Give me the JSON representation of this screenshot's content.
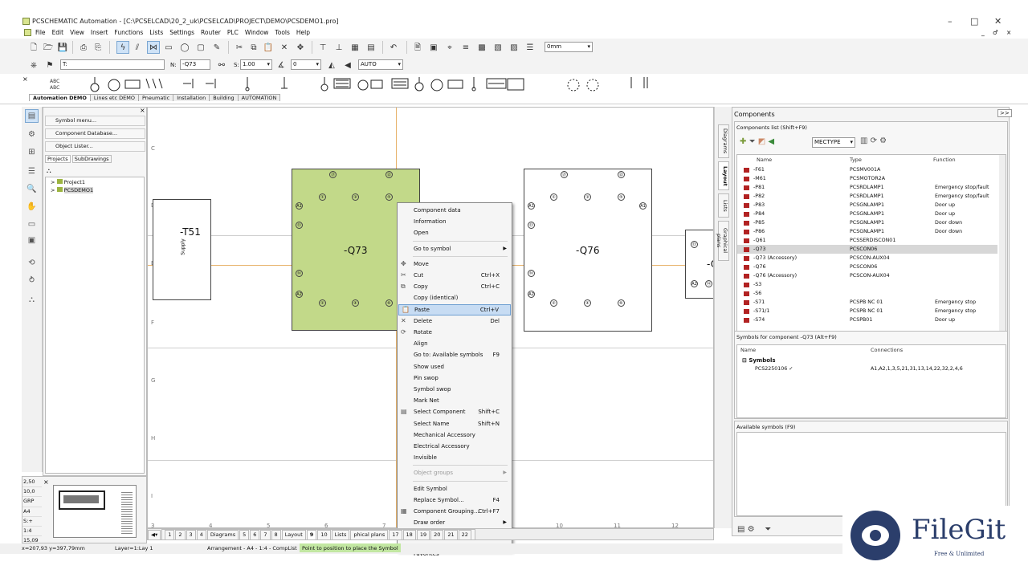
{
  "app": {
    "title": "PCSCHEMATIC Automation - [C:\\PCSELCAD\\20_2_uk\\PCSELCAD\\PROJECT\\DEMO\\PCSDEMO1.pro]",
    "min": "–",
    "max": "□",
    "close": "✕",
    "doc_min": "_",
    "doc_max": "♂",
    "doc_close": "×"
  },
  "menu": [
    "File",
    "Edit",
    "View",
    "Insert",
    "Functions",
    "Lists",
    "Settings",
    "Router",
    "PLC",
    "Window",
    "Tools",
    "Help"
  ],
  "toolbar": {
    "thickness": "0mm",
    "t_label": "T:",
    "n_label": "N:",
    "n_value": "-Q73",
    "s_label": "S:",
    "s_value": "1.00",
    "angle": "0",
    "auto": "AUTO"
  },
  "symbol_tabs": [
    "Automation DEMO",
    "Lines etc DEMO",
    "Pneumatic",
    "Installation",
    "Building",
    "AUTOMATION"
  ],
  "left_panel": {
    "buttons": [
      "Symbol menu...",
      "Component Database...",
      "Object Lister..."
    ],
    "tabs": [
      "Projects",
      "SubDrawings"
    ],
    "tree": [
      "Project1",
      "PCSDEMO1"
    ]
  },
  "canvas": {
    "rows": [
      "C",
      "D",
      "E",
      "F",
      "G",
      "H",
      "I"
    ],
    "cols": [
      "3",
      "4",
      "5",
      "6",
      "7",
      "8",
      "9",
      "10",
      "11",
      "12"
    ],
    "t51": "-T51",
    "t51_sub": "Supply",
    "q73": "-Q73",
    "q76": "-Q76",
    "q_partial": "-Q",
    "q73_terms": [
      "①",
      "③",
      "⑤",
      "⑬",
      "⑭",
      "②",
      "④",
      "⑥",
      "㉑",
      "㉒",
      "⑬",
      "⑭"
    ]
  },
  "context_menu": [
    {
      "label": "Component data"
    },
    {
      "label": "Information"
    },
    {
      "label": "Open"
    },
    {
      "sep": true
    },
    {
      "label": "Go to symbol",
      "sub": true
    },
    {
      "sep": true
    },
    {
      "label": "Move",
      "icon": "✥"
    },
    {
      "label": "Cut",
      "short": "Ctrl+X",
      "icon": "✂"
    },
    {
      "label": "Copy",
      "short": "Ctrl+C",
      "icon": "⧉"
    },
    {
      "label": "Copy (identical)"
    },
    {
      "label": "Paste",
      "short": "Ctrl+V",
      "icon": "📋",
      "hl": true
    },
    {
      "label": "Delete",
      "short": "Del",
      "icon": "✕"
    },
    {
      "label": "Rotate",
      "icon": "⟳"
    },
    {
      "label": "Align"
    },
    {
      "label": "Go to: Available symbols",
      "short": "F9"
    },
    {
      "label": "Show used"
    },
    {
      "label": "Pin swop"
    },
    {
      "label": "Symbol swop"
    },
    {
      "label": "Mark Net"
    },
    {
      "label": "Select Component",
      "short": "Shift+C",
      "icon": "▤"
    },
    {
      "label": "Select Name",
      "short": "Shift+N"
    },
    {
      "label": "Mechanical Accessory"
    },
    {
      "label": "Electrical Accessory"
    },
    {
      "label": "Invisible"
    },
    {
      "sep": true
    },
    {
      "label": "Object groups",
      "sub": true,
      "dis": true
    },
    {
      "sep": true
    },
    {
      "label": "Edit Symbol"
    },
    {
      "label": "Replace Symbol...",
      "short": "F4"
    },
    {
      "label": "Component Grouping...",
      "short": "Ctrl+F7",
      "icon": "▦"
    },
    {
      "label": "Draw order",
      "sub": true
    },
    {
      "sep": true
    },
    {
      "label": "Insert name"
    },
    {
      "sep": true
    },
    {
      "label": "Favorites"
    }
  ],
  "page_tabs": [
    "1",
    "2",
    "3",
    "4",
    "Diagrams",
    "5",
    "6",
    "7",
    "8",
    "Layout",
    "9",
    "10",
    "Lists",
    "phical plans",
    "17",
    "18",
    "19",
    "20",
    "21",
    "22"
  ],
  "status": {
    "coords": "x=207,93 y=397,79mm",
    "layer": "Layer=1:Lay 1",
    "arrangement": "Arrangement - A4 - 1:4 - CompList",
    "hint": "Point to position to place the Symbol"
  },
  "minimap": {
    "values": [
      "2,50",
      "10,0",
      "GRP",
      "A4",
      "S:+",
      "1:4",
      "15,09"
    ]
  },
  "right_tabs": [
    "Diagrams",
    "Layout",
    "Lists",
    "Graphical plans"
  ],
  "components": {
    "title": "Components",
    "collapse": ">>",
    "list_title": "Components list (Shift+F9)",
    "filter": "MECTYPE",
    "cols": [
      "Name",
      "Type",
      "Function"
    ],
    "rows": [
      [
        "-F61",
        "PCSMV001A",
        ""
      ],
      [
        "-M61",
        "PCSMOTOR2A",
        ""
      ],
      [
        "-P81",
        "PCSRDLAMP1",
        "Emergency stop/fault"
      ],
      [
        "-P82",
        "PCSRDLAMP1",
        "Emergency stop/fault"
      ],
      [
        "-P83",
        "PCSGNLAMP1",
        "Door up"
      ],
      [
        "-P84",
        "PCSGNLAMP1",
        "Door up"
      ],
      [
        "-P85",
        "PCSGNLAMP1",
        "Door down"
      ],
      [
        "-P86",
        "PCSGNLAMP1",
        "Door down"
      ],
      [
        "-Q61",
        "PCSSERDISCON01",
        ""
      ],
      [
        "-Q73",
        "PCSCON06",
        ""
      ],
      [
        "-Q73 (Accessory)",
        "PCSCON-AUX04",
        ""
      ],
      [
        "-Q76",
        "PCSCON06",
        ""
      ],
      [
        "-Q76 (Accessory)",
        "PCSCON-AUX04",
        ""
      ],
      [
        "-S3",
        "",
        ""
      ],
      [
        "-S6",
        "",
        ""
      ],
      [
        "-S71",
        "PCSPB NC 01",
        "Emergency stop"
      ],
      [
        "-S71/1",
        "PCSPB NC 01",
        "Emergency stop"
      ],
      [
        "-S74",
        "PCSPB01",
        "Door up"
      ]
    ],
    "symbols_title": "Symbols for component -Q73 (Alt+F9)",
    "sym_cols": [
      "Name",
      "Connections"
    ],
    "sym_group": "Symbols",
    "sym_row": "PCS2250106 ✓",
    "sym_conn": "A1,A2,1,3,5,21,31,13,14,22,32,2,4,6",
    "available": "Available symbols (F9)"
  },
  "watermark": {
    "brand": "FileGit",
    "tagline": "Free & Unlimited"
  },
  "colors": {
    "selected_fill": "#c2d989",
    "accent": "#7ba7d2"
  }
}
